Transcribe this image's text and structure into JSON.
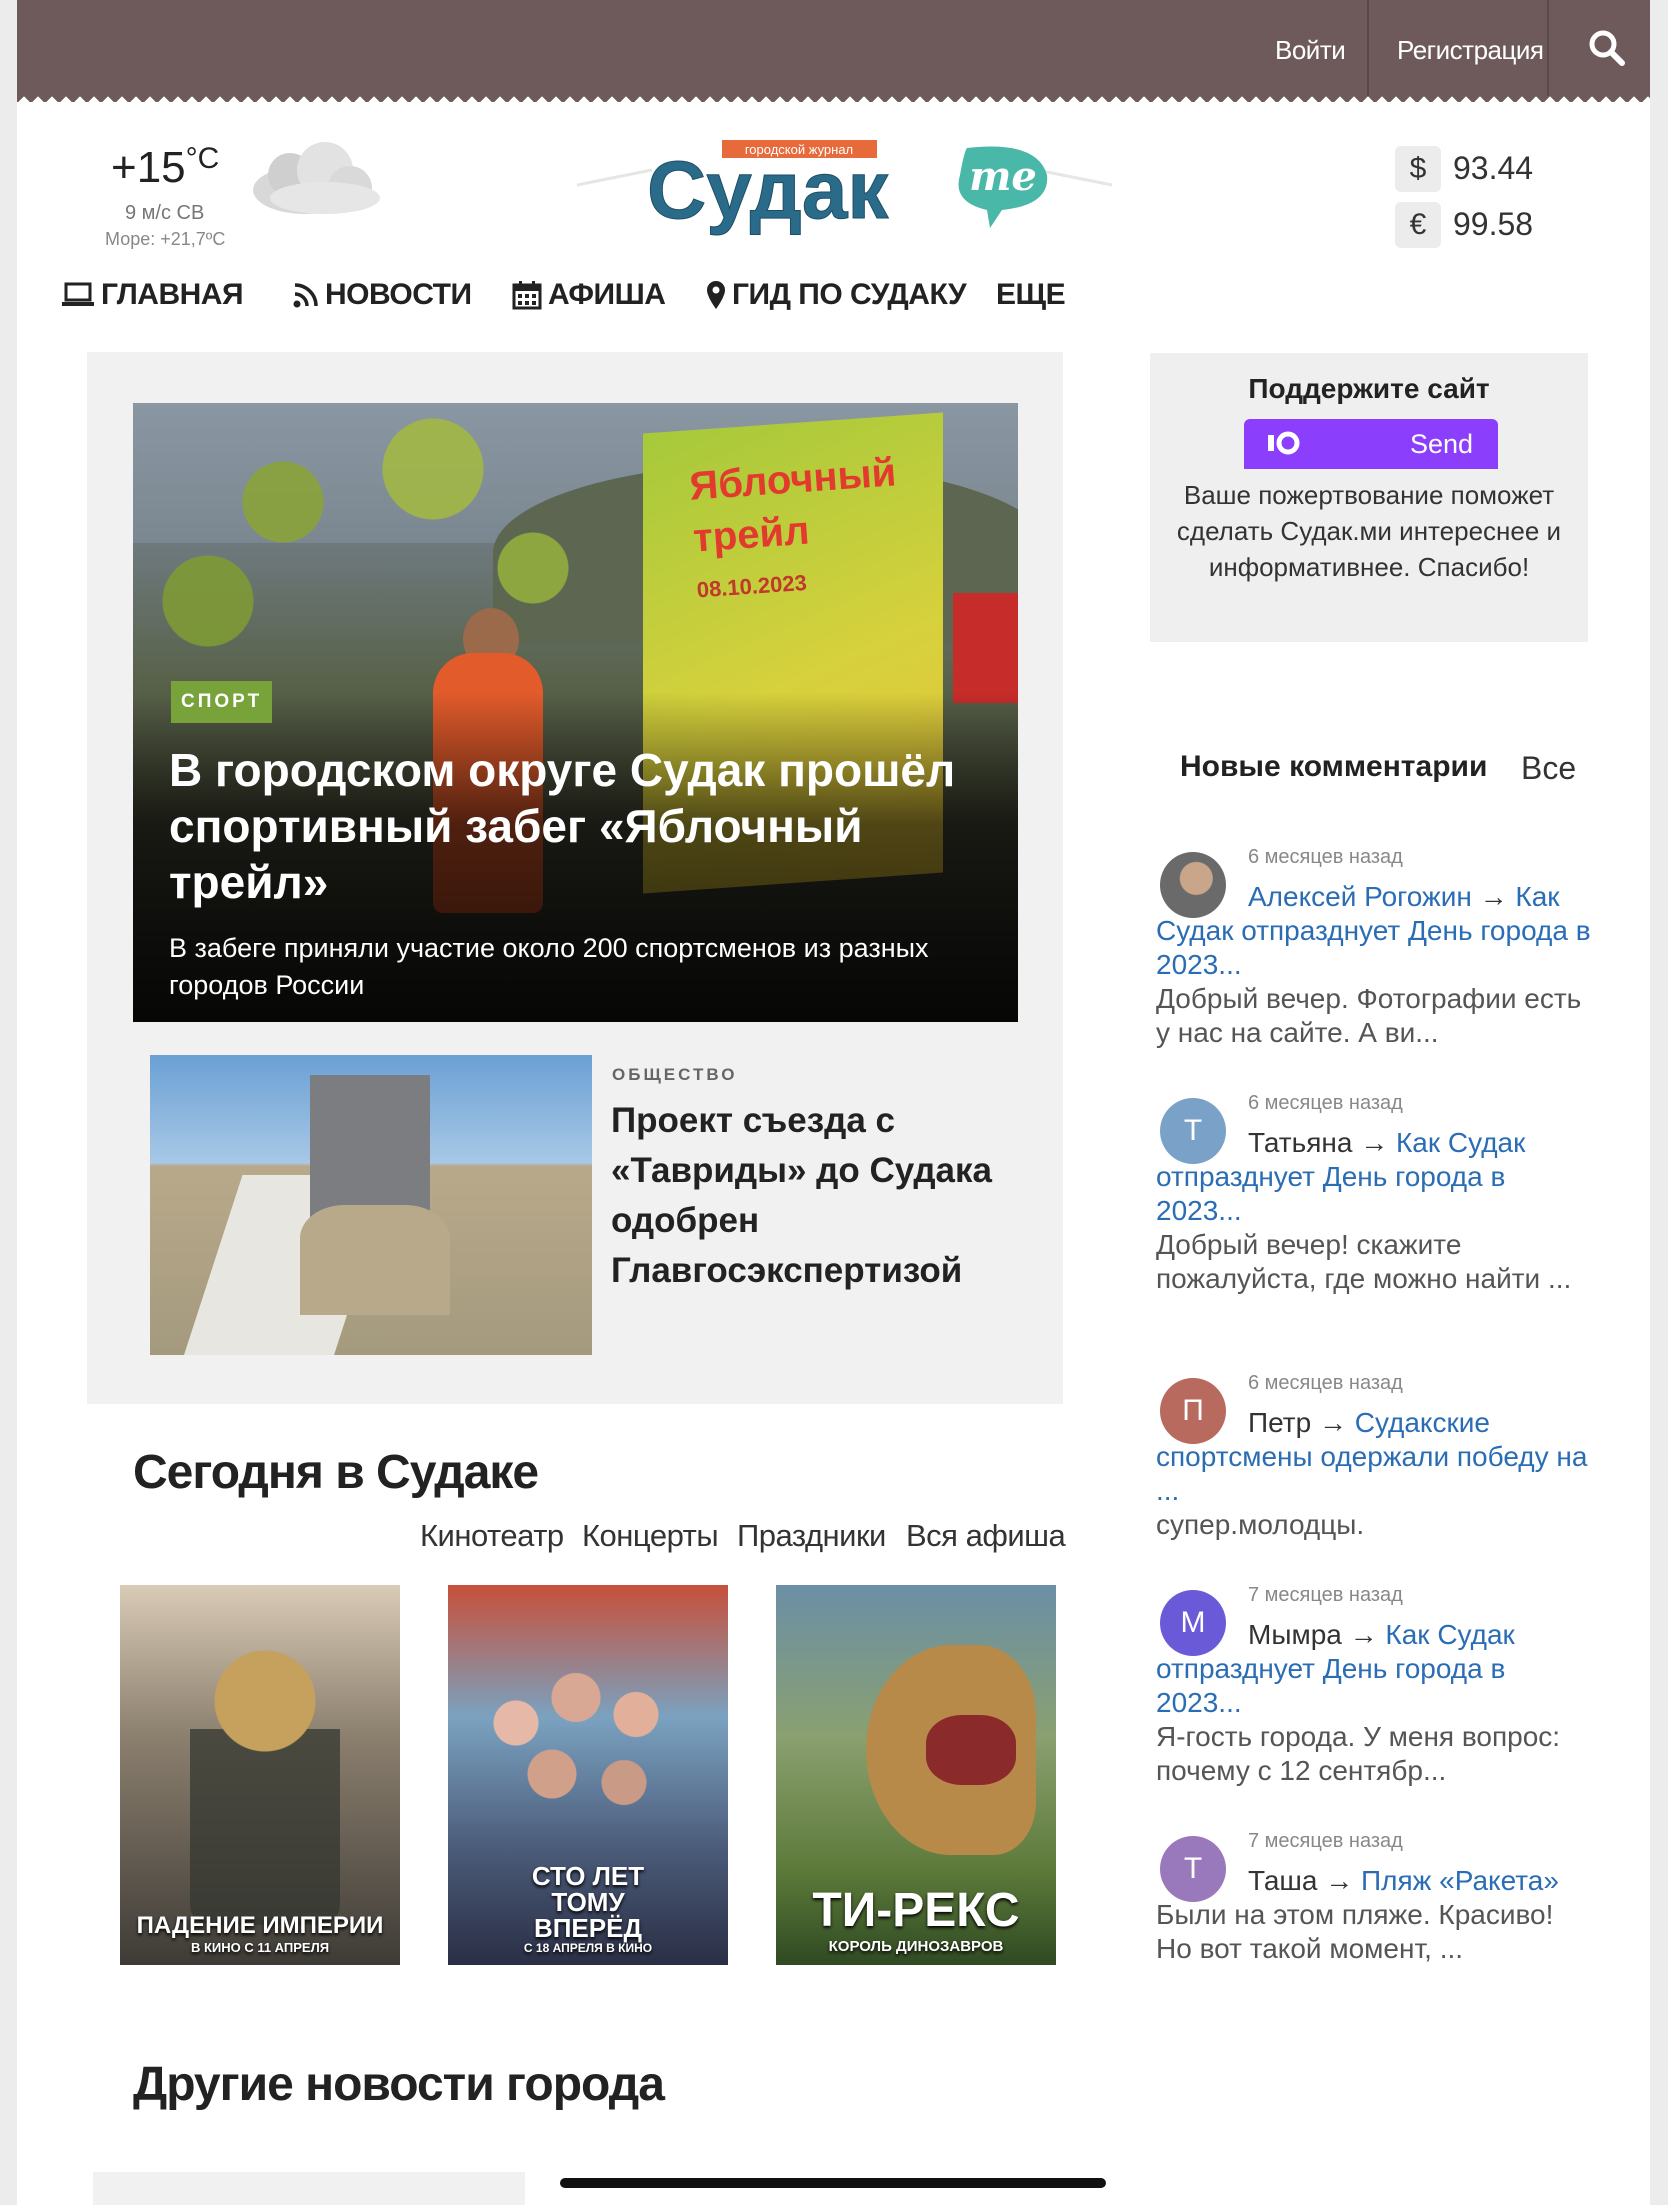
{
  "topbar": {
    "login": "Войти",
    "register": "Регистрация",
    "search_icon": "search-icon"
  },
  "weather": {
    "temp": "+15",
    "unit": "°C",
    "wind": "9 м/с СВ",
    "sea": "Море: +21,7ºC",
    "icon": "cloud-icon"
  },
  "logo": {
    "tagline": "городской журнал",
    "name": "Судак",
    "suffix": "me"
  },
  "currency": [
    {
      "symbol": "$",
      "value": "93.44"
    },
    {
      "symbol": "€",
      "value": "99.58"
    }
  ],
  "nav": [
    {
      "label": "ГЛАВНАЯ",
      "icon": "laptop-icon"
    },
    {
      "label": "НОВОСТИ",
      "icon": "rss-icon"
    },
    {
      "label": "АФИША",
      "icon": "calendar-icon"
    },
    {
      "label": "ГИД ПО СУДАКУ",
      "icon": "map-pin-icon"
    },
    {
      "label": "ЕЩЕ",
      "icon": ""
    }
  ],
  "hero": {
    "banner_text": "Яблочный трейл",
    "banner_date": "08.10.2023",
    "tag": "СПОРТ",
    "title": "В городском округе Судак прошёл спортивный забег «Яблочный трейл»",
    "subtitle": "В забеге приняли участие около 200 спортсменов из разных городов России"
  },
  "story2": {
    "tag": "ОБЩЕСТВО",
    "title": "Проект съезда с «Тавриды» до Судака одобрен Главгосэкспертизой"
  },
  "today": {
    "title": "Сегодня в Судаке",
    "tabs": [
      "Кинотеатр",
      "Концерты",
      "Праздники",
      "Вся афиша"
    ],
    "posters": [
      {
        "title": "ПАДЕНИЕ ИМПЕРИИ",
        "note": "В КИНО С 11 АПРЕЛЯ"
      },
      {
        "title": "СТО ЛЕТ ТОМУ ВПЕРЁД",
        "note": "С 18 АПРЕЛЯ В КИНО"
      },
      {
        "title": "ТИ-РЕКС",
        "note": "КОРОЛЬ ДИНОЗАВРОВ"
      }
    ]
  },
  "other_news": {
    "title": "Другие новости города"
  },
  "support": {
    "title": "Поддержите сайт",
    "button": "Send",
    "text": "Ваше пожертвование поможет сделать Судак.ми интереснее и информативнее. Спасибо!"
  },
  "comments": {
    "title": "Новые комментарии",
    "all": "Все",
    "items": [
      {
        "initial": "",
        "avatar_color": "#5a5a5a",
        "time": "6 месяцев назад",
        "author": "Алексей Рогожин",
        "arrow": "→",
        "post": "Как Судак отпразднует День города в 2023...",
        "text": "Добрый вечер. Фотографии есть у нас на сайте. А ви..."
      },
      {
        "initial": "Т",
        "avatar_color": "#7aa2c8",
        "time": "6 месяцев назад",
        "author": "Татьяна",
        "arrow": "→",
        "post": "Как Судак отпразднует День города в 2023...",
        "text": "Добрый вечер! скажите пожалуйста, где можно найти ..."
      },
      {
        "initial": "П",
        "avatar_color": "#b86a5e",
        "time": "6 месяцев назад",
        "author": "Петр",
        "arrow": "→",
        "post": "Судакские спортсмены одержали победу на ...",
        "text": "супер.молодцы."
      },
      {
        "initial": "М",
        "avatar_color": "#6a5ad8",
        "time": "7 месяцев назад",
        "author": "Мымра",
        "arrow": "→",
        "post": "Как Судак отпразднует День города в 2023...",
        "text": "Я-гость города. У меня вопрос: почему с 12 сентябр..."
      },
      {
        "initial": "Т",
        "avatar_color": "#9a78bc",
        "time": "7 месяцев назад",
        "author": "Таша",
        "arrow": "→",
        "post": "Пляж «Ракета»",
        "text": "Были на этом пляже. Красиво! Но вот такой момент, ..."
      }
    ]
  }
}
